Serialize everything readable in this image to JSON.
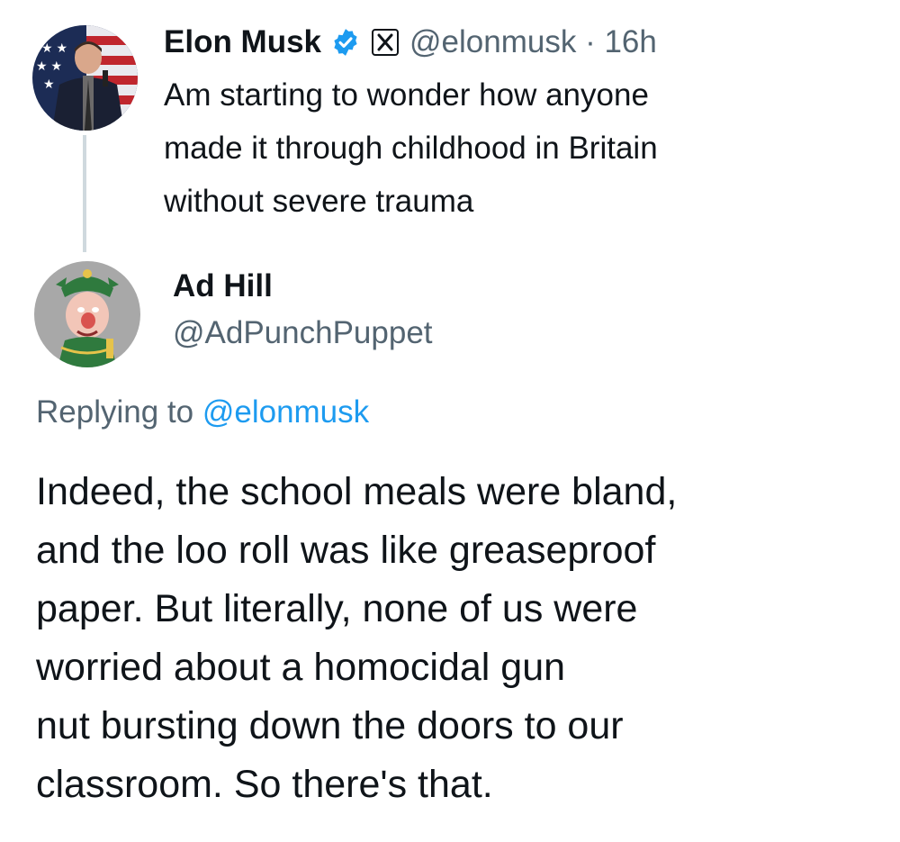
{
  "original_tweet": {
    "display_name": "Elon Musk",
    "handle": "@elonmusk",
    "separator": " · ",
    "time": "16h",
    "text_lines": [
      "Am starting to wonder how anyone",
      "made it through childhood in Britain",
      "without severe trauma"
    ],
    "icons": [
      "avatar",
      "verified-badge-icon",
      "x-logo-icon"
    ],
    "colors": {
      "verified": "#1d9bf0",
      "thread_line": "#cfd9de"
    }
  },
  "reply": {
    "display_name": "Ad Hill",
    "handle": "@AdPunchPuppet",
    "replying_prefix": "Replying to ",
    "replying_to": "@elonmusk",
    "text_lines": [
      "Indeed, the school meals were bland,",
      "and the loo roll was like greaseproof",
      "paper. But literally, none of us were",
      "worried about a homocidal gun",
      "nut bursting down the doors to our",
      "classroom. So there's that."
    ],
    "colors": {
      "mention": "#1d9bf0",
      "secondary_text": "#536471"
    }
  }
}
